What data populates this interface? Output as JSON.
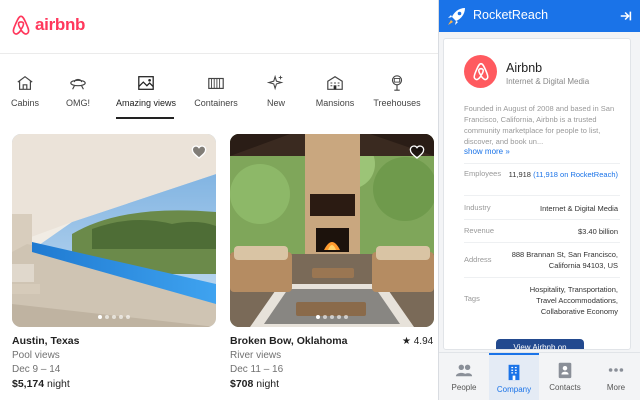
{
  "airbnb": {
    "logo_text": "airbnb",
    "brand_color": "#ff385c",
    "categories": [
      {
        "label": "Cabins",
        "icon": "cabin-icon"
      },
      {
        "label": "OMG!",
        "icon": "ufo-icon"
      },
      {
        "label": "Amazing views",
        "icon": "landscape-icon",
        "active": true
      },
      {
        "label": "Containers",
        "icon": "container-icon"
      },
      {
        "label": "New",
        "icon": "sparkle-icon"
      },
      {
        "label": "Mansions",
        "icon": "mansion-icon"
      },
      {
        "label": "Treehouses",
        "icon": "treehouse-icon"
      }
    ],
    "listings": [
      {
        "title": "Austin, Texas",
        "subtitle": "Pool views",
        "dates": "Dec 9 – 14",
        "price": "$5,174",
        "price_unit": "night"
      },
      {
        "title": "Broken Bow, Oklahoma",
        "subtitle": "River views",
        "dates": "Dec 11 – 16",
        "price": "$708",
        "price_unit": "night",
        "rating": "4.94"
      }
    ]
  },
  "rocketreach": {
    "title": "RocketReach",
    "accent": "#1a73e8",
    "company": {
      "name": "Airbnb",
      "industry_line": "Internet & Digital Media",
      "description": "Founded in August of 2008 and based in San Francisco, California, Airbnb is a trusted community marketplace for people to list, discover, and book un...",
      "show_more": "show more »",
      "fields": [
        {
          "key": "Employees",
          "value": "11,918",
          "link": "(11,918 on RocketReach)"
        },
        {
          "key": "Industry",
          "value": "Internet & Digital Media"
        },
        {
          "key": "Revenue",
          "value": "$3.40 billion"
        },
        {
          "key": "Address",
          "value": "888 Brannan St, San Francisco, California 94103, US"
        },
        {
          "key": "Tags",
          "value": "Hospitality, Transportation, Travel Accommodations, Collaborative Economy"
        }
      ],
      "button": "View Airbnb on"
    },
    "tabs": [
      {
        "label": "People",
        "icon": "people-icon"
      },
      {
        "label": "Company",
        "icon": "building-icon",
        "active": true
      },
      {
        "label": "Contacts",
        "icon": "contact-card-icon"
      },
      {
        "label": "More",
        "icon": "more-dots-icon"
      }
    ]
  }
}
